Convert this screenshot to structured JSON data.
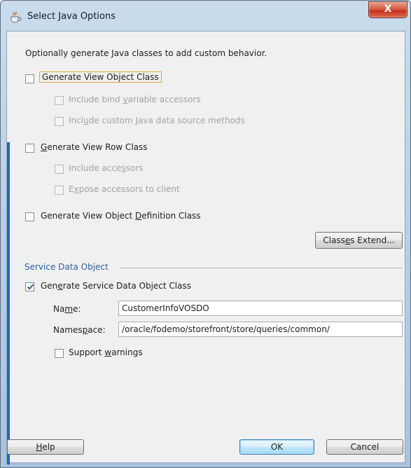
{
  "window": {
    "title": "Select Java Options",
    "close_label": "X"
  },
  "intro_text": "Optionally generate Java classes to add custom behavior.",
  "options": {
    "view_object_class": {
      "pre": "Generate View Ob",
      "u": "j",
      "post": "ect Class",
      "checked": false
    },
    "bind_variable_accessors": {
      "pre": "Include bind ",
      "u": "v",
      "post": "ariable accessors",
      "checked": false
    },
    "custom_data_source_methods": {
      "pre": "Incl",
      "u": "u",
      "post": "de custom Java data source methods",
      "checked": false
    },
    "view_row_class": {
      "pre": "",
      "u": "G",
      "post": "enerate View Row Class",
      "checked": false
    },
    "include_accessors": {
      "pre": "Include acce",
      "u": "s",
      "post": "sors",
      "checked": false
    },
    "expose_accessors": {
      "pre": "E",
      "u": "x",
      "post": "pose accessors to client",
      "checked": false
    },
    "view_object_definition_class": {
      "pre": "Generate View Object ",
      "u": "D",
      "post": "efinition Class",
      "checked": false
    }
  },
  "classes_extend_button": {
    "pre": "Class",
    "u": "e",
    "post": "s Extend..."
  },
  "sdo": {
    "section_title": "Service Data Object",
    "generate": {
      "pre": "Gen",
      "u": "e",
      "post": "rate Service Data Object Class",
      "checked": true
    },
    "name_label": {
      "pre": "Na",
      "u": "m",
      "post": "e:"
    },
    "name_value": "CustomerInfoVOSDO",
    "namespace_label": {
      "pre": "Names",
      "u": "p",
      "post": "ace:"
    },
    "namespace_value": "/oracle/fodemo/storefront/store/queries/common/",
    "support_warnings": {
      "pre": "Support ",
      "u": "w",
      "post": "arnings",
      "checked": false
    }
  },
  "footer": {
    "help": {
      "pre": "",
      "u": "H",
      "post": "elp"
    },
    "ok": "OK",
    "cancel": "Cancel"
  },
  "colors": {
    "accent": "#2d5fa8",
    "focus": "#e3a43c",
    "close": "#c7301a"
  }
}
